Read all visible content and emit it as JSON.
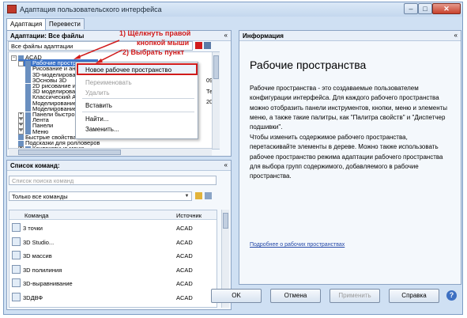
{
  "window": {
    "title": "Адаптация пользовательского интерфейса"
  },
  "tabs": [
    "Адаптация",
    "Перевести"
  ],
  "left_panel": {
    "header": "Адаптации: Все файлы",
    "filter_label": "Все файлы адаптации",
    "tree": [
      {
        "label": "ACAD",
        "level": 0,
        "expander": "−"
      },
      {
        "label": "Рабочие пространства",
        "level": 1,
        "expander": "−",
        "selected": true
      },
      {
        "label": "Рисование и аннотации",
        "level": 2
      },
      {
        "label": "3D-моделирование",
        "level": 2
      },
      {
        "label": "3Основы 3D",
        "level": 2
      },
      {
        "label": "2D рисование и оформление",
        "level": 2
      },
      {
        "label": "3D моделирование",
        "level": 2
      },
      {
        "label": "Классический AutoCAD",
        "level": 2
      },
      {
        "label": "Моделирование",
        "level": 2
      },
      {
        "label": "Моделирование",
        "level": 2
      },
      {
        "label": "Панели быстрого доступа",
        "level": 1,
        "expander": "+"
      },
      {
        "label": "Лента",
        "level": 1,
        "expander": "+"
      },
      {
        "label": "Панели",
        "level": 1,
        "expander": "+"
      },
      {
        "label": "Меню",
        "level": 1,
        "expander": "+"
      },
      {
        "label": "Быстрые свойства",
        "level": 1
      },
      {
        "label": "Подсказки для ролловеров",
        "level": 1
      },
      {
        "label": "Контекстные меню",
        "level": 1,
        "expander": "+"
      }
    ],
    "tree_right_fragments": [
      "09",
      "Текущ",
      "2009"
    ]
  },
  "context_menu": {
    "items": [
      "Новое рабочее пространство",
      "Переименовать",
      "Удалить",
      "Вставить",
      "Найти...",
      "Заменить..."
    ],
    "disabled": [
      false,
      true,
      true,
      false,
      false,
      false
    ]
  },
  "annotations": {
    "step1_line1": "1) Щёлкнуть правой",
    "step1_line2": "кнопкой мыши",
    "step2": "2) Выбрать пункт"
  },
  "commands_panel": {
    "header": "Список команд:",
    "search_placeholder": "Список поиска команд",
    "filter_value": "Только все команды",
    "columns": [
      "Команда",
      "Источник"
    ],
    "rows": [
      {
        "name": "3 точки",
        "source": "ACAD"
      },
      {
        "name": "3D Studio...",
        "source": "ACAD"
      },
      {
        "name": "3D массив",
        "source": "ACAD"
      },
      {
        "name": "3D полилиния",
        "source": "ACAD"
      },
      {
        "name": "3D-выравнивание",
        "source": "ACAD"
      },
      {
        "name": "3DДВФ",
        "source": "ACAD"
      }
    ]
  },
  "info_panel": {
    "header": "Информация",
    "title": "Рабочие пространства",
    "paragraph1": "Рабочие пространства - это создаваемые пользователем конфигурации интерфейса. Для каждого рабочего пространства можно отобразить панели инструментов, кнопки, меню и элементы меню, а также такие палитры, как \"Палитра свойств\" и \"Диспетчер подшивки\".",
    "paragraph2": "Чтобы изменить содержимое рабочего пространства, перетаскивайте элементы в дереве. Можно также использовать рабочее пространство режима адаптации рабочего пространства для выбора групп содержимого, добавляемого в рабочие пространства.",
    "link": "Подробнее о рабочих пространствах"
  },
  "buttons": {
    "ok": "OK",
    "cancel": "Отмена",
    "apply": "Применить",
    "help": "Справка"
  },
  "colors": {
    "annotation": "#d11b1b",
    "selection": "#3d74c9",
    "link": "#2549a8"
  }
}
